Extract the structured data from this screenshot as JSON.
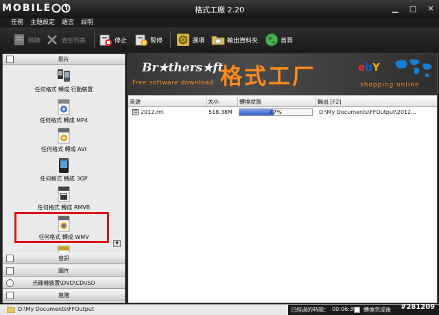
{
  "watermark": {
    "logo": "MOBILE01",
    "id": "#281209"
  },
  "window": {
    "title": "格式工廠 2.20"
  },
  "menu": [
    "任務",
    "主題設定",
    "語言",
    "說明"
  ],
  "toolbar": {
    "remove": "移除",
    "clear": "清空列表",
    "stop": "停止",
    "pause": "暫停",
    "options": "選項",
    "output_folder": "輸出資料夾",
    "home": "首頁"
  },
  "sidebar": {
    "video_header": "影片",
    "formats": [
      {
        "label": "任何格式 轉成 行動裝置",
        "badge": ""
      },
      {
        "label": "任何格式 轉成 MP4",
        "badge": "MP4"
      },
      {
        "label": "任何格式 轉成 AVI",
        "badge": "AVI"
      },
      {
        "label": "任何格式 轉成 3GP",
        "badge": "3GP"
      },
      {
        "label": "任何格式 轉成 RMVB",
        "badge": "RM"
      },
      {
        "label": "任何格式 轉成 WMV",
        "badge": "WMV"
      },
      {
        "label": "",
        "badge": "MKV"
      }
    ],
    "categories": [
      "音訊",
      "圖片",
      "光碟機裝置\\DVD\\CD\\ISO",
      "進階"
    ]
  },
  "banner": {
    "brothersoft": "Br★thers★ft",
    "tagline": "Free software download",
    "title": "格式工厂",
    "ebay": [
      "e",
      "b",
      "Y"
    ],
    "shopping": "shopping online",
    "colors": {
      "orange": "#ff8a1a",
      "ebay_e": "#e53238",
      "ebay_b": "#0064d2",
      "ebay_Y": "#f5af02"
    }
  },
  "table": {
    "headers": [
      "來源",
      "大小",
      "轉換狀態",
      "輸出 [F2]"
    ],
    "rows": [
      {
        "source": "2012.rm",
        "size": "518.38M",
        "status": "47%",
        "progress": 0.47,
        "output": "D:\\My Documents\\FFOutput\\2012..."
      }
    ]
  },
  "statusbar": {
    "path": "D:\\My Documents\\FFOutput",
    "elapsed_label": "已經過的時間：",
    "elapsed_time": "00:06:39",
    "after_convert": "轉換完成後"
  }
}
